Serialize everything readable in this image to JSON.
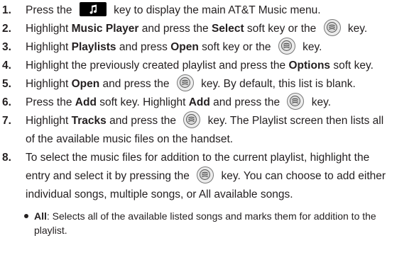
{
  "steps": [
    {
      "num": "1.",
      "lines": [
        [
          "Press the ",
          {
            "icon": "music-key"
          },
          " key to display the main AT&T Music menu."
        ]
      ]
    },
    {
      "num": "2.",
      "lines": [
        [
          "Highlight ",
          {
            "b": "Music Player"
          },
          " and press the ",
          {
            "b": "Select"
          },
          " soft key or the ",
          {
            "icon": "ok-key"
          },
          " key."
        ]
      ]
    },
    {
      "num": "3.",
      "lines": [
        [
          "Highlight ",
          {
            "b": "Playlists"
          },
          " and press ",
          {
            "b": "Open"
          },
          " soft key or the ",
          {
            "icon": "ok-key"
          },
          " key."
        ]
      ]
    },
    {
      "num": "4.",
      "lines": [
        [
          "Highlight the previously created playlist and press the ",
          {
            "b": "Options"
          },
          " soft key."
        ]
      ]
    },
    {
      "num": "5.",
      "lines": [
        [
          "Highlight ",
          {
            "b": "Open"
          },
          " and press the ",
          {
            "icon": "ok-key"
          },
          " key. By default, this list is blank."
        ]
      ]
    },
    {
      "num": "6.",
      "lines": [
        [
          "Press the ",
          {
            "b": "Add"
          },
          " soft key. Highlight ",
          {
            "b": "Add"
          },
          " and press the ",
          {
            "icon": "ok-key"
          },
          " key."
        ]
      ]
    },
    {
      "num": "7.",
      "lines": [
        [
          "Highlight ",
          {
            "b": "Tracks"
          },
          " and press the ",
          {
            "icon": "ok-key"
          },
          " key. The Playlist screen then lists all"
        ],
        [
          "of the available music files on the handset."
        ]
      ]
    },
    {
      "num": "8.",
      "lines": [
        [
          "To select the music files for addition to the current playlist, highlight the"
        ],
        [
          "entry and select it by pressing the ",
          {
            "icon": "ok-key"
          },
          " key. You can choose to add either"
        ],
        [
          "individual songs, multiple songs, or All available songs."
        ]
      ]
    }
  ],
  "bullets": [
    {
      "lines": [
        [
          {
            "b": "All"
          },
          ": Selects all of the available listed songs and marks them for addition to the"
        ],
        [
          "playlist."
        ]
      ]
    }
  ]
}
